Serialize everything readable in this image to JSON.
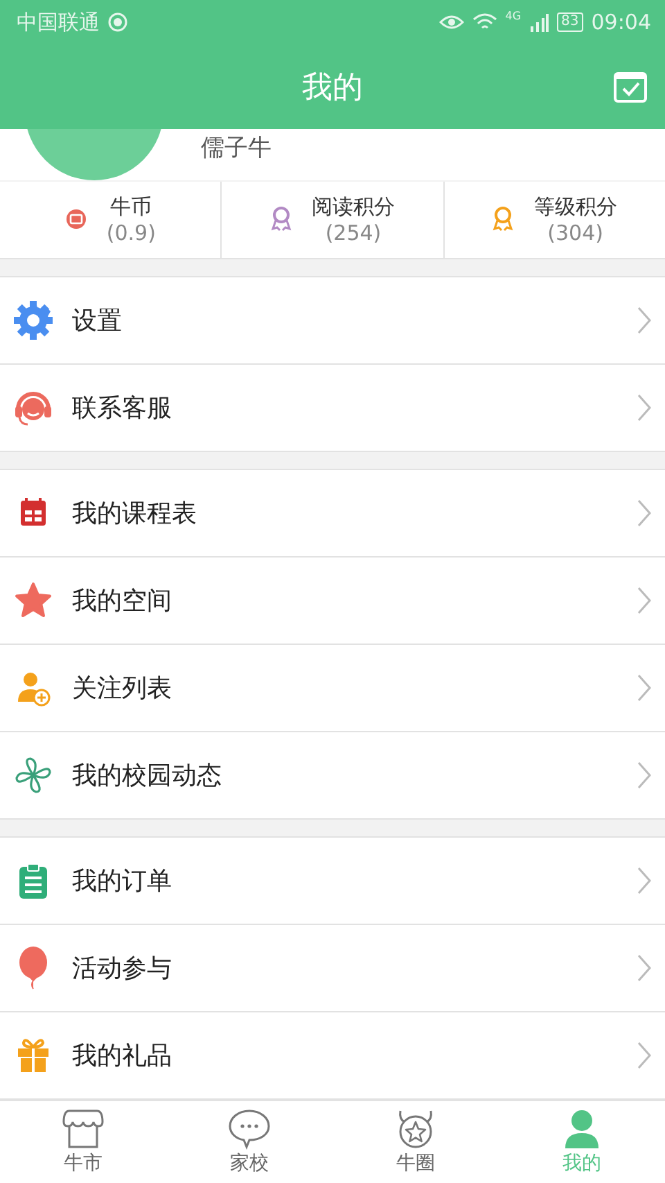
{
  "status_bar": {
    "carrier": "中国联通",
    "network": "4G",
    "battery": "83",
    "time": "09:04"
  },
  "header": {
    "title": "我的"
  },
  "profile": {
    "name": "儒子牛"
  },
  "stats": [
    {
      "label": "牛币",
      "value": "(0.9)"
    },
    {
      "label": "阅读积分",
      "value": "(254)"
    },
    {
      "label": "等级积分",
      "value": "(304)"
    }
  ],
  "menu_groups": [
    [
      {
        "label": "设置"
      },
      {
        "label": "联系客服"
      }
    ],
    [
      {
        "label": "我的课程表"
      },
      {
        "label": "我的空间"
      },
      {
        "label": "关注列表"
      },
      {
        "label": "我的校园动态"
      }
    ],
    [
      {
        "label": "我的订单"
      },
      {
        "label": "活动参与"
      },
      {
        "label": "我的礼品"
      }
    ]
  ],
  "tabs": [
    {
      "label": "牛市",
      "selected": false
    },
    {
      "label": "家校",
      "selected": false
    },
    {
      "label": "牛圈",
      "selected": false
    },
    {
      "label": "我的",
      "selected": true
    }
  ]
}
